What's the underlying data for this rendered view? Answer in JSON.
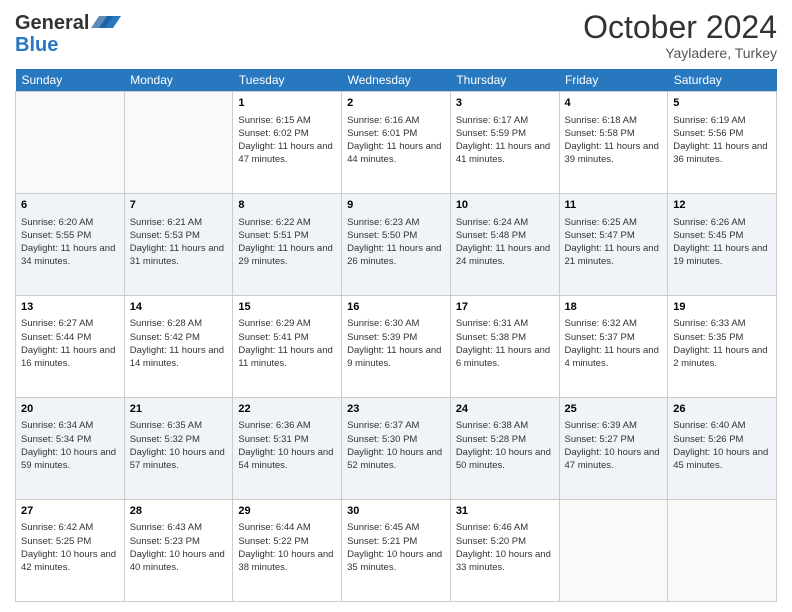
{
  "header": {
    "logo_line1": "General",
    "logo_line2": "Blue",
    "month_title": "October 2024",
    "location": "Yayladere, Turkey"
  },
  "days_of_week": [
    "Sunday",
    "Monday",
    "Tuesday",
    "Wednesday",
    "Thursday",
    "Friday",
    "Saturday"
  ],
  "weeks": [
    [
      {
        "day": "",
        "info": ""
      },
      {
        "day": "",
        "info": ""
      },
      {
        "day": "1",
        "info": "Sunrise: 6:15 AM\nSunset: 6:02 PM\nDaylight: 11 hours and 47 minutes."
      },
      {
        "day": "2",
        "info": "Sunrise: 6:16 AM\nSunset: 6:01 PM\nDaylight: 11 hours and 44 minutes."
      },
      {
        "day": "3",
        "info": "Sunrise: 6:17 AM\nSunset: 5:59 PM\nDaylight: 11 hours and 41 minutes."
      },
      {
        "day": "4",
        "info": "Sunrise: 6:18 AM\nSunset: 5:58 PM\nDaylight: 11 hours and 39 minutes."
      },
      {
        "day": "5",
        "info": "Sunrise: 6:19 AM\nSunset: 5:56 PM\nDaylight: 11 hours and 36 minutes."
      }
    ],
    [
      {
        "day": "6",
        "info": "Sunrise: 6:20 AM\nSunset: 5:55 PM\nDaylight: 11 hours and 34 minutes."
      },
      {
        "day": "7",
        "info": "Sunrise: 6:21 AM\nSunset: 5:53 PM\nDaylight: 11 hours and 31 minutes."
      },
      {
        "day": "8",
        "info": "Sunrise: 6:22 AM\nSunset: 5:51 PM\nDaylight: 11 hours and 29 minutes."
      },
      {
        "day": "9",
        "info": "Sunrise: 6:23 AM\nSunset: 5:50 PM\nDaylight: 11 hours and 26 minutes."
      },
      {
        "day": "10",
        "info": "Sunrise: 6:24 AM\nSunset: 5:48 PM\nDaylight: 11 hours and 24 minutes."
      },
      {
        "day": "11",
        "info": "Sunrise: 6:25 AM\nSunset: 5:47 PM\nDaylight: 11 hours and 21 minutes."
      },
      {
        "day": "12",
        "info": "Sunrise: 6:26 AM\nSunset: 5:45 PM\nDaylight: 11 hours and 19 minutes."
      }
    ],
    [
      {
        "day": "13",
        "info": "Sunrise: 6:27 AM\nSunset: 5:44 PM\nDaylight: 11 hours and 16 minutes."
      },
      {
        "day": "14",
        "info": "Sunrise: 6:28 AM\nSunset: 5:42 PM\nDaylight: 11 hours and 14 minutes."
      },
      {
        "day": "15",
        "info": "Sunrise: 6:29 AM\nSunset: 5:41 PM\nDaylight: 11 hours and 11 minutes."
      },
      {
        "day": "16",
        "info": "Sunrise: 6:30 AM\nSunset: 5:39 PM\nDaylight: 11 hours and 9 minutes."
      },
      {
        "day": "17",
        "info": "Sunrise: 6:31 AM\nSunset: 5:38 PM\nDaylight: 11 hours and 6 minutes."
      },
      {
        "day": "18",
        "info": "Sunrise: 6:32 AM\nSunset: 5:37 PM\nDaylight: 11 hours and 4 minutes."
      },
      {
        "day": "19",
        "info": "Sunrise: 6:33 AM\nSunset: 5:35 PM\nDaylight: 11 hours and 2 minutes."
      }
    ],
    [
      {
        "day": "20",
        "info": "Sunrise: 6:34 AM\nSunset: 5:34 PM\nDaylight: 10 hours and 59 minutes."
      },
      {
        "day": "21",
        "info": "Sunrise: 6:35 AM\nSunset: 5:32 PM\nDaylight: 10 hours and 57 minutes."
      },
      {
        "day": "22",
        "info": "Sunrise: 6:36 AM\nSunset: 5:31 PM\nDaylight: 10 hours and 54 minutes."
      },
      {
        "day": "23",
        "info": "Sunrise: 6:37 AM\nSunset: 5:30 PM\nDaylight: 10 hours and 52 minutes."
      },
      {
        "day": "24",
        "info": "Sunrise: 6:38 AM\nSunset: 5:28 PM\nDaylight: 10 hours and 50 minutes."
      },
      {
        "day": "25",
        "info": "Sunrise: 6:39 AM\nSunset: 5:27 PM\nDaylight: 10 hours and 47 minutes."
      },
      {
        "day": "26",
        "info": "Sunrise: 6:40 AM\nSunset: 5:26 PM\nDaylight: 10 hours and 45 minutes."
      }
    ],
    [
      {
        "day": "27",
        "info": "Sunrise: 6:42 AM\nSunset: 5:25 PM\nDaylight: 10 hours and 42 minutes."
      },
      {
        "day": "28",
        "info": "Sunrise: 6:43 AM\nSunset: 5:23 PM\nDaylight: 10 hours and 40 minutes."
      },
      {
        "day": "29",
        "info": "Sunrise: 6:44 AM\nSunset: 5:22 PM\nDaylight: 10 hours and 38 minutes."
      },
      {
        "day": "30",
        "info": "Sunrise: 6:45 AM\nSunset: 5:21 PM\nDaylight: 10 hours and 35 minutes."
      },
      {
        "day": "31",
        "info": "Sunrise: 6:46 AM\nSunset: 5:20 PM\nDaylight: 10 hours and 33 minutes."
      },
      {
        "day": "",
        "info": ""
      },
      {
        "day": "",
        "info": ""
      }
    ]
  ]
}
